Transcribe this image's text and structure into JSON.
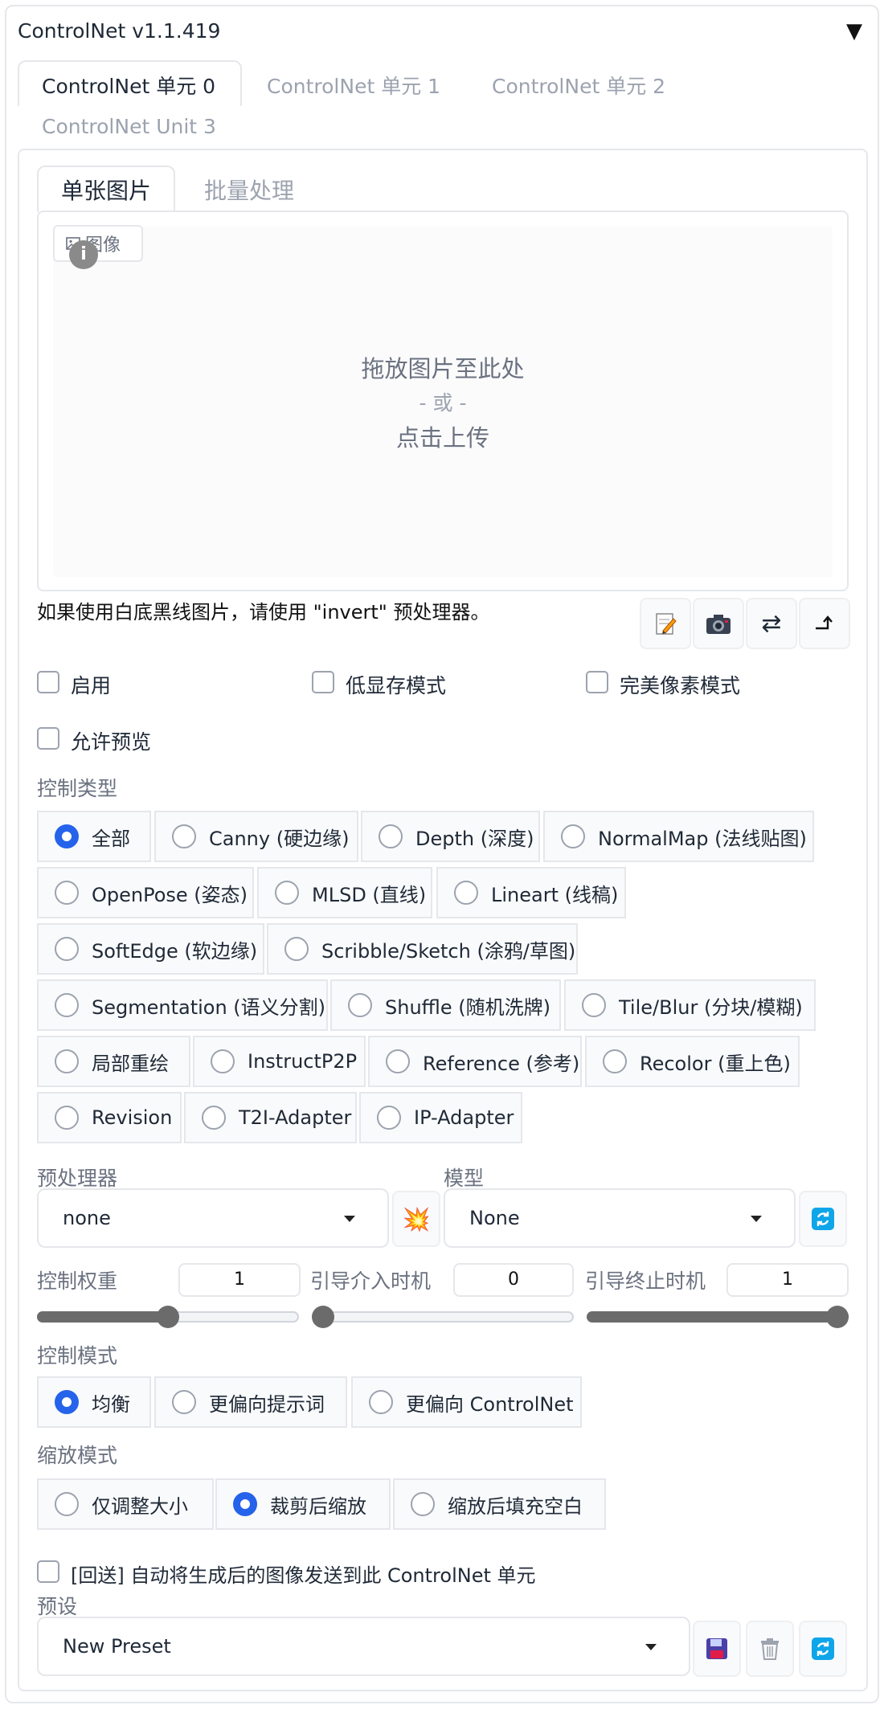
{
  "header": {
    "title": "ControlNet v1.1.419",
    "collapse_glyph": "▼"
  },
  "unit_tabs": [
    "ControlNet 单元 0",
    "ControlNet 单元 1",
    "ControlNet 单元 2",
    "ControlNet Unit 3"
  ],
  "input_tabs": [
    "单张图片",
    "批量处理"
  ],
  "upload": {
    "label": "图像",
    "info_glyph": "i",
    "drop_line1": "拖放图片至此处",
    "drop_line2": "- 或 -",
    "drop_line3": "点击上传"
  },
  "hint_text": "如果使用白底黑线图片，请使用 \"invert\" 预处理器。",
  "tool_icons": [
    "edit-icon",
    "camera-icon",
    "swap-icon",
    "send-icon"
  ],
  "checkboxes": {
    "enable": "启用",
    "low_vram": "低显存模式",
    "pixel_perfect": "完美像素模式",
    "allow_preview": "允许预览"
  },
  "control_type": {
    "label": "控制类型",
    "selected": "全部",
    "options": [
      "全部",
      "Canny (硬边缘)",
      "Depth (深度)",
      "NormalMap (法线贴图)",
      "OpenPose (姿态)",
      "MLSD (直线)",
      "Lineart (线稿)",
      "SoftEdge (软边缘)",
      "Scribble/Sketch (涂鸦/草图)",
      "Segmentation (语义分割)",
      "Shuffle (随机洗牌)",
      "Tile/Blur (分块/模糊)",
      "局部重绘",
      "InstructP2P",
      "Reference (参考)",
      "Recolor (重上色)",
      "Revision",
      "T2I-Adapter",
      "IP-Adapter"
    ]
  },
  "preprocessor": {
    "label": "预处理器",
    "value": "none",
    "run_icon": "💥"
  },
  "model": {
    "label": "模型",
    "value": "None",
    "refresh_icon": "🔄"
  },
  "sliders": {
    "weight": {
      "label": "控制权重",
      "value": "1",
      "fraction": 0.5
    },
    "start": {
      "label": "引导介入时机",
      "value": "0",
      "fraction": 0.0
    },
    "end": {
      "label": "引导终止时机",
      "value": "1",
      "fraction": 1.0
    }
  },
  "control_mode": {
    "label": "控制模式",
    "selected": "均衡",
    "options": [
      "均衡",
      "更偏向提示词",
      "更偏向 ControlNet"
    ]
  },
  "resize_mode": {
    "label": "缩放模式",
    "selected": "裁剪后缩放",
    "options": [
      "仅调整大小",
      "裁剪后缩放",
      "缩放后填充空白"
    ]
  },
  "loopback": {
    "label": "[回送] 自动将生成后的图像发送到此 ControlNet 单元"
  },
  "preset": {
    "label": "预设",
    "value": "New Preset",
    "save_icon": "💾",
    "delete_icon": "🗑",
    "refresh_icon": "🔄"
  },
  "colors": {
    "accent": "#2563eb",
    "border": "#e5e7eb",
    "muted": "#9ca3af"
  }
}
